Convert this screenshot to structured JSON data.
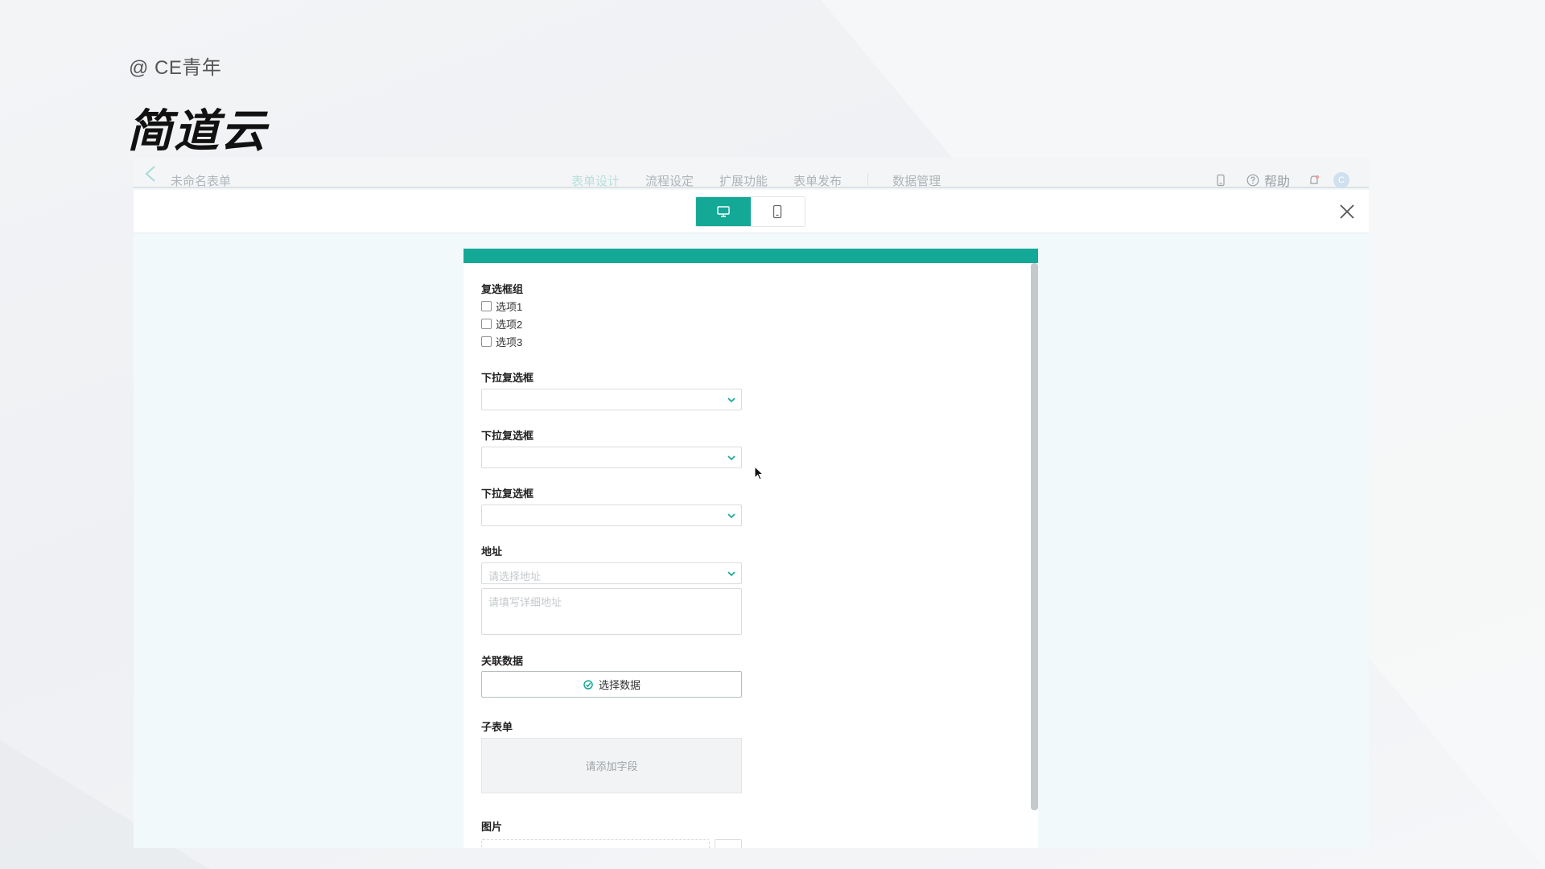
{
  "credit": "@ CE青年",
  "brand": "简道云",
  "app": {
    "form_name": "未命名表单",
    "nav": [
      {
        "label": "表单设计",
        "active": true
      },
      {
        "label": "流程设定",
        "active": false
      },
      {
        "label": "扩展功能",
        "active": false
      },
      {
        "label": "表单发布",
        "active": false
      },
      {
        "label": "数据管理",
        "active": false
      }
    ],
    "help_label": "帮助",
    "avatar_initial": "C",
    "accent_color": "#14a896"
  },
  "form": {
    "checkbox_group": {
      "label": "复选框组",
      "options": [
        "选项1",
        "选项2",
        "选项3"
      ]
    },
    "dropdowns": [
      {
        "label": "下拉复选框",
        "value": ""
      },
      {
        "label": "下拉复选框",
        "value": ""
      },
      {
        "label": "下拉复选框",
        "value": ""
      }
    ],
    "address": {
      "label": "地址",
      "select_placeholder": "请选择地址",
      "detail_placeholder": "请填写详细地址"
    },
    "linked_data": {
      "label": "关联数据",
      "button_label": "选择数据"
    },
    "subform": {
      "label": "子表单",
      "placeholder": "请添加字段"
    },
    "image": {
      "label": "图片"
    }
  }
}
